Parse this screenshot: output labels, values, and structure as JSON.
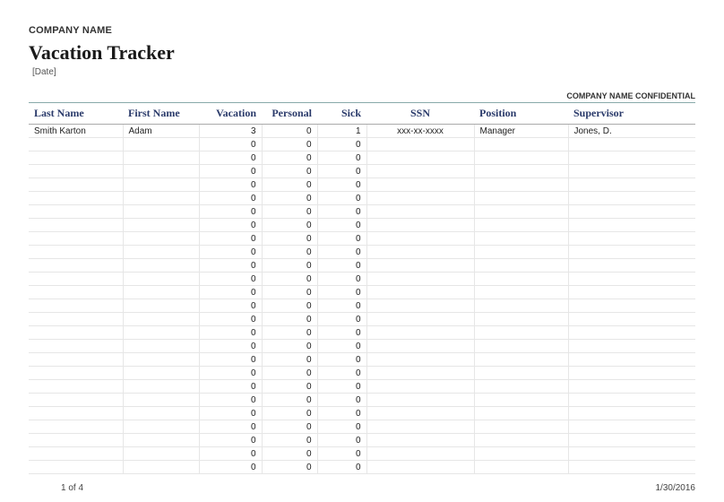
{
  "header": {
    "company": "COMPANY NAME",
    "title": "Vacation Tracker",
    "date": "[Date]",
    "confidential": "COMPANY NAME CONFIDENTIAL"
  },
  "columns": {
    "last_name": "Last Name",
    "first_name": "First Name",
    "vacation": "Vacation",
    "personal": "Personal",
    "sick": "Sick",
    "ssn": "SSN",
    "position": "Position",
    "supervisor": "Supervisor"
  },
  "rows": [
    {
      "last_name": "Smith Karton",
      "first_name": "Adam",
      "vacation": 3,
      "personal": 0,
      "sick": 1,
      "ssn": "xxx-xx-xxxx",
      "position": "Manager",
      "supervisor": "Jones, D."
    },
    {
      "last_name": "",
      "first_name": "",
      "vacation": 0,
      "personal": 0,
      "sick": 0,
      "ssn": "",
      "position": "",
      "supervisor": ""
    },
    {
      "last_name": "",
      "first_name": "",
      "vacation": 0,
      "personal": 0,
      "sick": 0,
      "ssn": "",
      "position": "",
      "supervisor": ""
    },
    {
      "last_name": "",
      "first_name": "",
      "vacation": 0,
      "personal": 0,
      "sick": 0,
      "ssn": "",
      "position": "",
      "supervisor": ""
    },
    {
      "last_name": "",
      "first_name": "",
      "vacation": 0,
      "personal": 0,
      "sick": 0,
      "ssn": "",
      "position": "",
      "supervisor": ""
    },
    {
      "last_name": "",
      "first_name": "",
      "vacation": 0,
      "personal": 0,
      "sick": 0,
      "ssn": "",
      "position": "",
      "supervisor": ""
    },
    {
      "last_name": "",
      "first_name": "",
      "vacation": 0,
      "personal": 0,
      "sick": 0,
      "ssn": "",
      "position": "",
      "supervisor": ""
    },
    {
      "last_name": "",
      "first_name": "",
      "vacation": 0,
      "personal": 0,
      "sick": 0,
      "ssn": "",
      "position": "",
      "supervisor": ""
    },
    {
      "last_name": "",
      "first_name": "",
      "vacation": 0,
      "personal": 0,
      "sick": 0,
      "ssn": "",
      "position": "",
      "supervisor": ""
    },
    {
      "last_name": "",
      "first_name": "",
      "vacation": 0,
      "personal": 0,
      "sick": 0,
      "ssn": "",
      "position": "",
      "supervisor": ""
    },
    {
      "last_name": "",
      "first_name": "",
      "vacation": 0,
      "personal": 0,
      "sick": 0,
      "ssn": "",
      "position": "",
      "supervisor": ""
    },
    {
      "last_name": "",
      "first_name": "",
      "vacation": 0,
      "personal": 0,
      "sick": 0,
      "ssn": "",
      "position": "",
      "supervisor": ""
    },
    {
      "last_name": "",
      "first_name": "",
      "vacation": 0,
      "personal": 0,
      "sick": 0,
      "ssn": "",
      "position": "",
      "supervisor": ""
    },
    {
      "last_name": "",
      "first_name": "",
      "vacation": 0,
      "personal": 0,
      "sick": 0,
      "ssn": "",
      "position": "",
      "supervisor": ""
    },
    {
      "last_name": "",
      "first_name": "",
      "vacation": 0,
      "personal": 0,
      "sick": 0,
      "ssn": "",
      "position": "",
      "supervisor": ""
    },
    {
      "last_name": "",
      "first_name": "",
      "vacation": 0,
      "personal": 0,
      "sick": 0,
      "ssn": "",
      "position": "",
      "supervisor": ""
    },
    {
      "last_name": "",
      "first_name": "",
      "vacation": 0,
      "personal": 0,
      "sick": 0,
      "ssn": "",
      "position": "",
      "supervisor": ""
    },
    {
      "last_name": "",
      "first_name": "",
      "vacation": 0,
      "personal": 0,
      "sick": 0,
      "ssn": "",
      "position": "",
      "supervisor": ""
    },
    {
      "last_name": "",
      "first_name": "",
      "vacation": 0,
      "personal": 0,
      "sick": 0,
      "ssn": "",
      "position": "",
      "supervisor": ""
    },
    {
      "last_name": "",
      "first_name": "",
      "vacation": 0,
      "personal": 0,
      "sick": 0,
      "ssn": "",
      "position": "",
      "supervisor": ""
    },
    {
      "last_name": "",
      "first_name": "",
      "vacation": 0,
      "personal": 0,
      "sick": 0,
      "ssn": "",
      "position": "",
      "supervisor": ""
    },
    {
      "last_name": "",
      "first_name": "",
      "vacation": 0,
      "personal": 0,
      "sick": 0,
      "ssn": "",
      "position": "",
      "supervisor": ""
    },
    {
      "last_name": "",
      "first_name": "",
      "vacation": 0,
      "personal": 0,
      "sick": 0,
      "ssn": "",
      "position": "",
      "supervisor": ""
    },
    {
      "last_name": "",
      "first_name": "",
      "vacation": 0,
      "personal": 0,
      "sick": 0,
      "ssn": "",
      "position": "",
      "supervisor": ""
    },
    {
      "last_name": "",
      "first_name": "",
      "vacation": 0,
      "personal": 0,
      "sick": 0,
      "ssn": "",
      "position": "",
      "supervisor": ""
    },
    {
      "last_name": "",
      "first_name": "",
      "vacation": 0,
      "personal": 0,
      "sick": 0,
      "ssn": "",
      "position": "",
      "supervisor": ""
    }
  ],
  "footer": {
    "page": "1 of 4",
    "date": "1/30/2016"
  }
}
